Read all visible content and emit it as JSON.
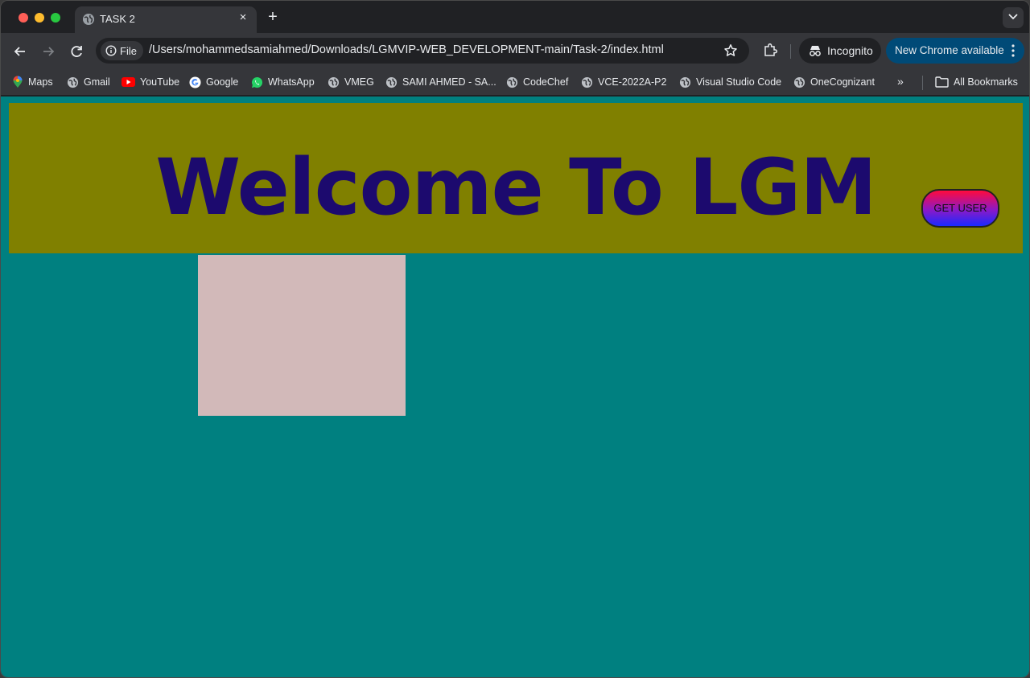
{
  "tab": {
    "title": "TASK 2",
    "close_glyph": "×",
    "new_tab_glyph": "+"
  },
  "toolbar": {
    "chip_label": "File",
    "url": "/Users/mohammedsamiahmed/Downloads/LGMVIP-WEB_DEVELOPMENT-main/Task-2/index.html",
    "incognito_label": "Incognito",
    "update_label": "New Chrome available"
  },
  "bookmarks": {
    "items": [
      {
        "label": "Maps",
        "icon": "maps-icon"
      },
      {
        "label": "Gmail",
        "icon": "globe-icon"
      },
      {
        "label": "YouTube",
        "icon": "youtube-icon"
      },
      {
        "label": "Google",
        "icon": "google-icon"
      },
      {
        "label": "WhatsApp",
        "icon": "whatsapp-icon"
      },
      {
        "label": "VMEG",
        "icon": "globe-icon"
      },
      {
        "label": "SAMI AHMED - SA...",
        "icon": "globe-icon"
      },
      {
        "label": "CodeChef",
        "icon": "globe-icon"
      },
      {
        "label": "VCE-2022A-P2",
        "icon": "globe-icon"
      },
      {
        "label": "Visual Studio Code",
        "icon": "globe-icon"
      },
      {
        "label": "OneCognizant",
        "icon": "globe-icon"
      }
    ],
    "more_glyph": "»",
    "all_bookmarks_label": "All Bookmarks"
  },
  "page": {
    "heading": "Welcome To LGM",
    "button_label": "GET USER"
  },
  "colors": {
    "page_background": "#008080",
    "header_band": "#808000",
    "heading_text": "#1c0a6e",
    "user_box": "#d2b9b9",
    "update_pill": "#004a77"
  }
}
